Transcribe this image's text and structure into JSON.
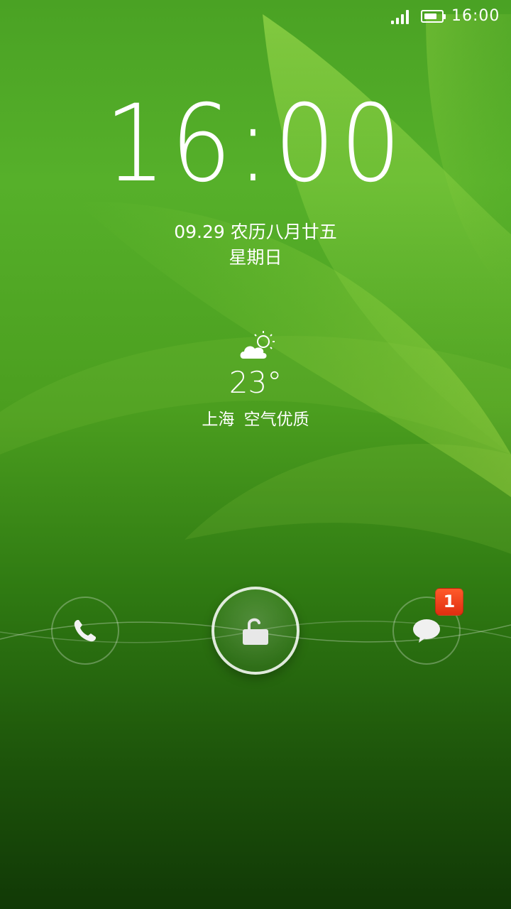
{
  "status_bar": {
    "time": "16:00",
    "signal_icon": "signal-icon",
    "battery_icon": "battery-icon",
    "battery_level": 0.75
  },
  "clock": {
    "time": "16:00"
  },
  "date": {
    "line": "09.29 农历八月廿五",
    "weekday": "星期日"
  },
  "weather": {
    "icon": "partly-cloudy-icon",
    "temperature": "23°",
    "location": "上海  空气优质"
  },
  "dock": {
    "phone_icon": "phone-icon",
    "unlock_icon": "unlock-icon",
    "message_icon": "message-icon",
    "message_badge": "1"
  },
  "colors": {
    "background_top": "#4aa224",
    "background_bottom": "#113906",
    "badge": "#f04020"
  }
}
